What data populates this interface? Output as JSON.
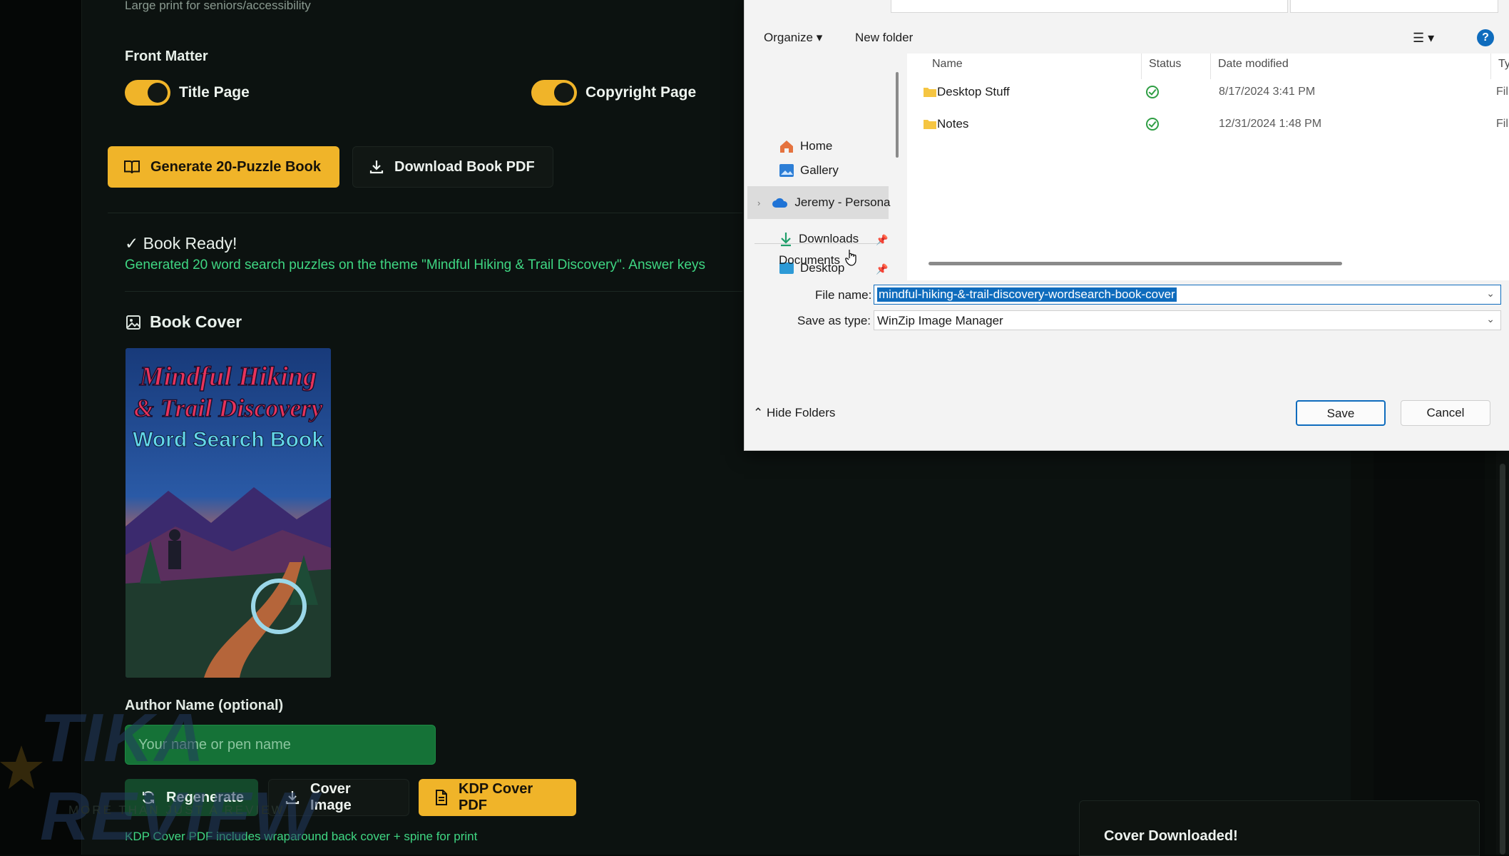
{
  "app": {
    "tiny_top": "Large print for seniors/accessibility",
    "front_matter_label": "Front Matter",
    "toggles": [
      {
        "label": "Title Page",
        "on": true
      },
      {
        "label": "Copyright Page",
        "on": true
      }
    ],
    "generate_button": "Generate 20-Puzzle Book",
    "download_pdf_button": "Download Book PDF",
    "ready_title": "✓ Book Ready!",
    "ready_text": "Generated 20 word search puzzles on the theme \"Mindful Hiking & Trail Discovery\". Answer keys",
    "cover_section_title": "Book Cover",
    "cover_title_lines": [
      "Mindful Hiking",
      "& Trail Discovery",
      "Word Search Book"
    ],
    "author_label": "Author Name (optional)",
    "author_placeholder": "Your name or pen name",
    "regenerate_button": "Regenerate",
    "cover_image_button": "Cover Image",
    "kdp_cover_button": "KDP Cover PDF",
    "kdp_note": "KDP Cover PDF includes wraparound back cover + spine for print",
    "toast": "Cover Downloaded!",
    "accent_color": "#f0b429",
    "success_color": "#3fd783"
  },
  "watermark": {
    "text": "TIKA REVIEW",
    "tagline": "MORE THAN JUST A REVIEW"
  },
  "dialog": {
    "organize": "Organize",
    "new_folder": "New folder",
    "nav": [
      {
        "label": "Home"
      },
      {
        "label": "Gallery"
      },
      {
        "label": "Jeremy - Persona"
      },
      {
        "label": "Desktop"
      },
      {
        "label": "Downloads"
      },
      {
        "label": "Documents"
      }
    ],
    "columns": [
      "Name",
      "Status",
      "Date modified",
      "Ty"
    ],
    "files": [
      {
        "name": "Desktop Stuff",
        "status": "ok",
        "date": "8/17/2024 3:41 PM",
        "type": "Fil"
      },
      {
        "name": "Notes",
        "status": "ok",
        "date": "12/31/2024 1:48 PM",
        "type": "Fil"
      }
    ],
    "file_name_label": "File name:",
    "file_name": "mindful-hiking-&-trail-discovery-wordsearch-book-cover",
    "save_as_label": "Save as type:",
    "save_as_value": "WinZip Image Manager",
    "hide_folders": "Hide Folders",
    "save": "Save",
    "cancel": "Cancel"
  }
}
